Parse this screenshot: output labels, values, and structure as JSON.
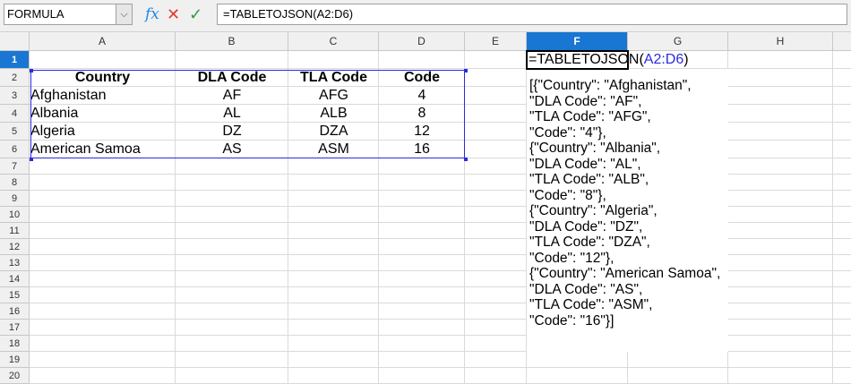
{
  "toolbar": {
    "name_box": "FORMULA",
    "formula": "=TABLETOJSON(A2:D6)",
    "fx_icon": "fx",
    "cancel_icon": "✕",
    "accept_icon": "✓"
  },
  "columns": [
    "A",
    "B",
    "C",
    "D",
    "E",
    "F",
    "G",
    "H"
  ],
  "rows": [
    "1",
    "2",
    "3",
    "4",
    "5",
    "6",
    "7",
    "8",
    "9",
    "10",
    "11",
    "12",
    "13",
    "14",
    "15",
    "16",
    "17",
    "18",
    "19",
    "20"
  ],
  "selected_cell": "F1",
  "table": {
    "headers": [
      "Country",
      "DLA Code",
      "TLA Code",
      "Code"
    ],
    "rows": [
      [
        "Afghanistan",
        "AF",
        "AFG",
        "4"
      ],
      [
        "Albania",
        "AL",
        "ALB",
        "8"
      ],
      [
        "Algeria",
        "DZ",
        "DZA",
        "12"
      ],
      [
        "American Samoa",
        "AS",
        "ASM",
        "16"
      ]
    ]
  },
  "f1": {
    "prefix": "=TABLETOJSON(",
    "ref": "A2:D6",
    "suffix": ")"
  },
  "f2_output": "[{\"Country\": \"Afghanistan\",\n\"DLA Code\": \"AF\",\n\"TLA Code\": \"AFG\",\n\"Code\": \"4\"},\n{\"Country\": \"Albania\",\n\"DLA Code\": \"AL\",\n\"TLA Code\": \"ALB\",\n\"Code\": \"8\"},\n{\"Country\": \"Algeria\",\n\"DLA Code\": \"DZ\",\n\"TLA Code\": \"DZA\",\n\"Code\": \"12\"},\n{\"Country\": \"American Samoa\",\n\"DLA Code\": \"AS\",\n\"TLA Code\": \"ASM\",\n\"Code\": \"16\"}]",
  "colors": {
    "selection": "#1976d2",
    "range_border": "#2a2ae0"
  }
}
